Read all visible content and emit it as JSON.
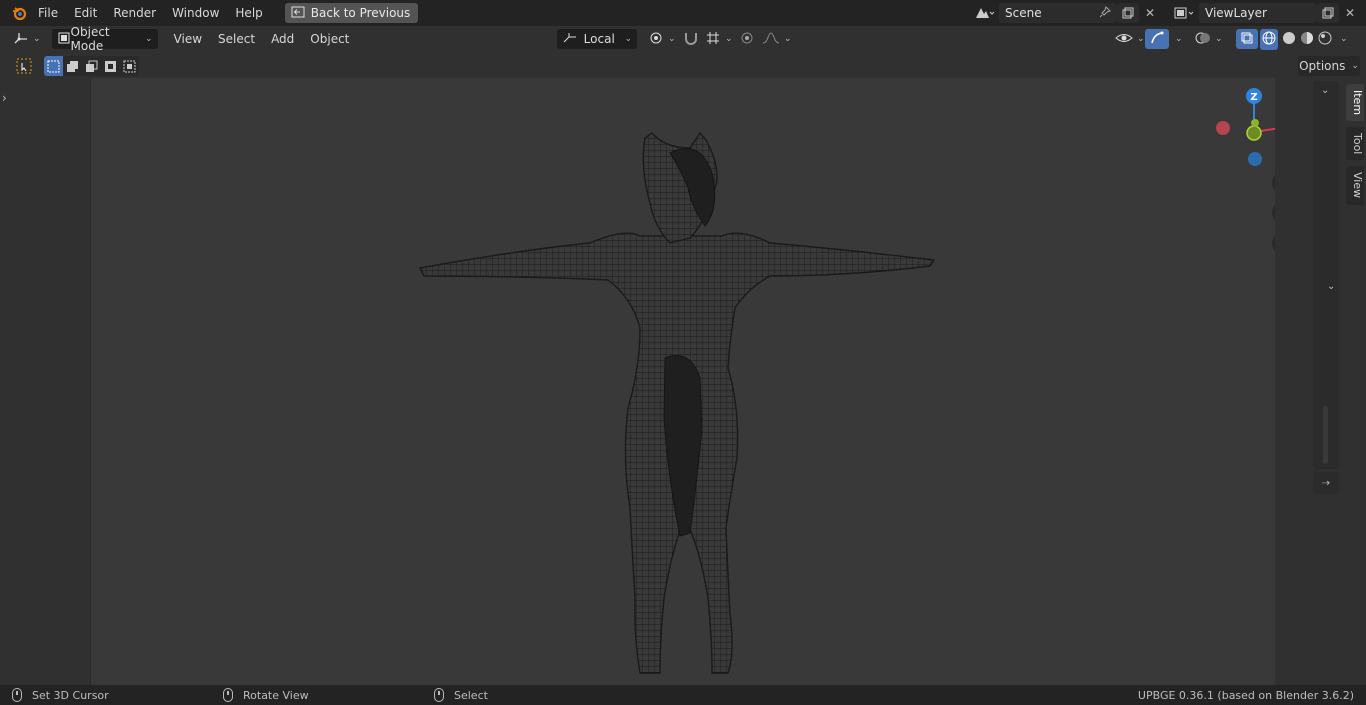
{
  "menu": {
    "file": "File",
    "edit": "Edit",
    "render": "Render",
    "window": "Window",
    "help": "Help",
    "back_to_previous": "Back to Previous"
  },
  "scene": {
    "name": "Scene"
  },
  "view_layer": {
    "name": "ViewLayer"
  },
  "view_header": {
    "mode": "Object Mode",
    "view": "View",
    "select": "Select",
    "add": "Add",
    "object": "Object",
    "transform_orientation": "Local"
  },
  "tool_settings": {
    "options": "Options"
  },
  "gizmo": {
    "z": "Z",
    "x": "X"
  },
  "sidebar_tabs": {
    "item": "Item",
    "tool": "Tool",
    "view": "View"
  },
  "status": {
    "set_cursor": "Set 3D Cursor",
    "rotate_view": "Rotate View",
    "select": "Select",
    "version": "UPBGE 0.36.1 (based on Blender 3.6.2)"
  },
  "colors": {
    "accent": "#4772b3",
    "axis_x": "#e0394f",
    "axis_y": "#8ab626",
    "axis_z": "#2f86d8"
  }
}
